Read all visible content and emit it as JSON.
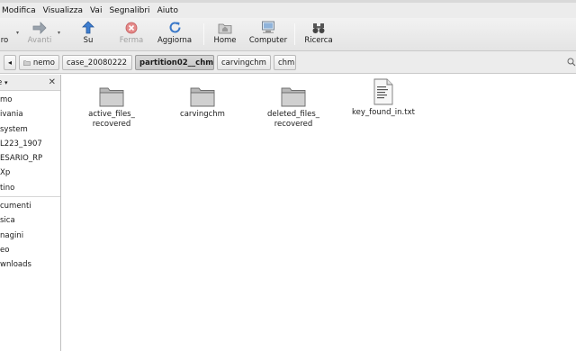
{
  "menubar": {
    "items": [
      {
        "label": "Modifica"
      },
      {
        "label": "Visualizza"
      },
      {
        "label": "Vai"
      },
      {
        "label": "Segnalibri"
      },
      {
        "label": "Aiuto"
      }
    ]
  },
  "toolbar": {
    "back_label": "ro",
    "forward_label": "Avanti",
    "up_label": "Su",
    "stop_label": "Ferma",
    "reload_label": "Aggiorna",
    "home_label": "Home",
    "computer_label": "Computer",
    "search_label": "Ricerca"
  },
  "location": {
    "crumbs": [
      "nemo",
      "case_20080222",
      "partition02__chm",
      "carvingchm",
      "chm"
    ],
    "active_crumb": "partition02__chm"
  },
  "sidebar": {
    "title": "e",
    "places": [
      "mo",
      "ivania",
      " system",
      "L223_1907",
      "ESARIO_RP",
      "Xp",
      "tino"
    ],
    "bookmarks": [
      "cumenti",
      "sica",
      "nagini",
      "eo",
      "wnloads"
    ]
  },
  "files": [
    {
      "name": "active_files_\nrecovered",
      "type": "folder"
    },
    {
      "name": "carvingchm",
      "type": "folder"
    },
    {
      "name": "deleted_files_\nrecovered",
      "type": "folder"
    },
    {
      "name": "key_found_in.txt",
      "type": "text-file"
    }
  ],
  "colors": {
    "folder_fill": "#c8c8c8",
    "toolbar_bg": "#e8e8e8",
    "active_crumb_bg": "#cfcfcf"
  }
}
